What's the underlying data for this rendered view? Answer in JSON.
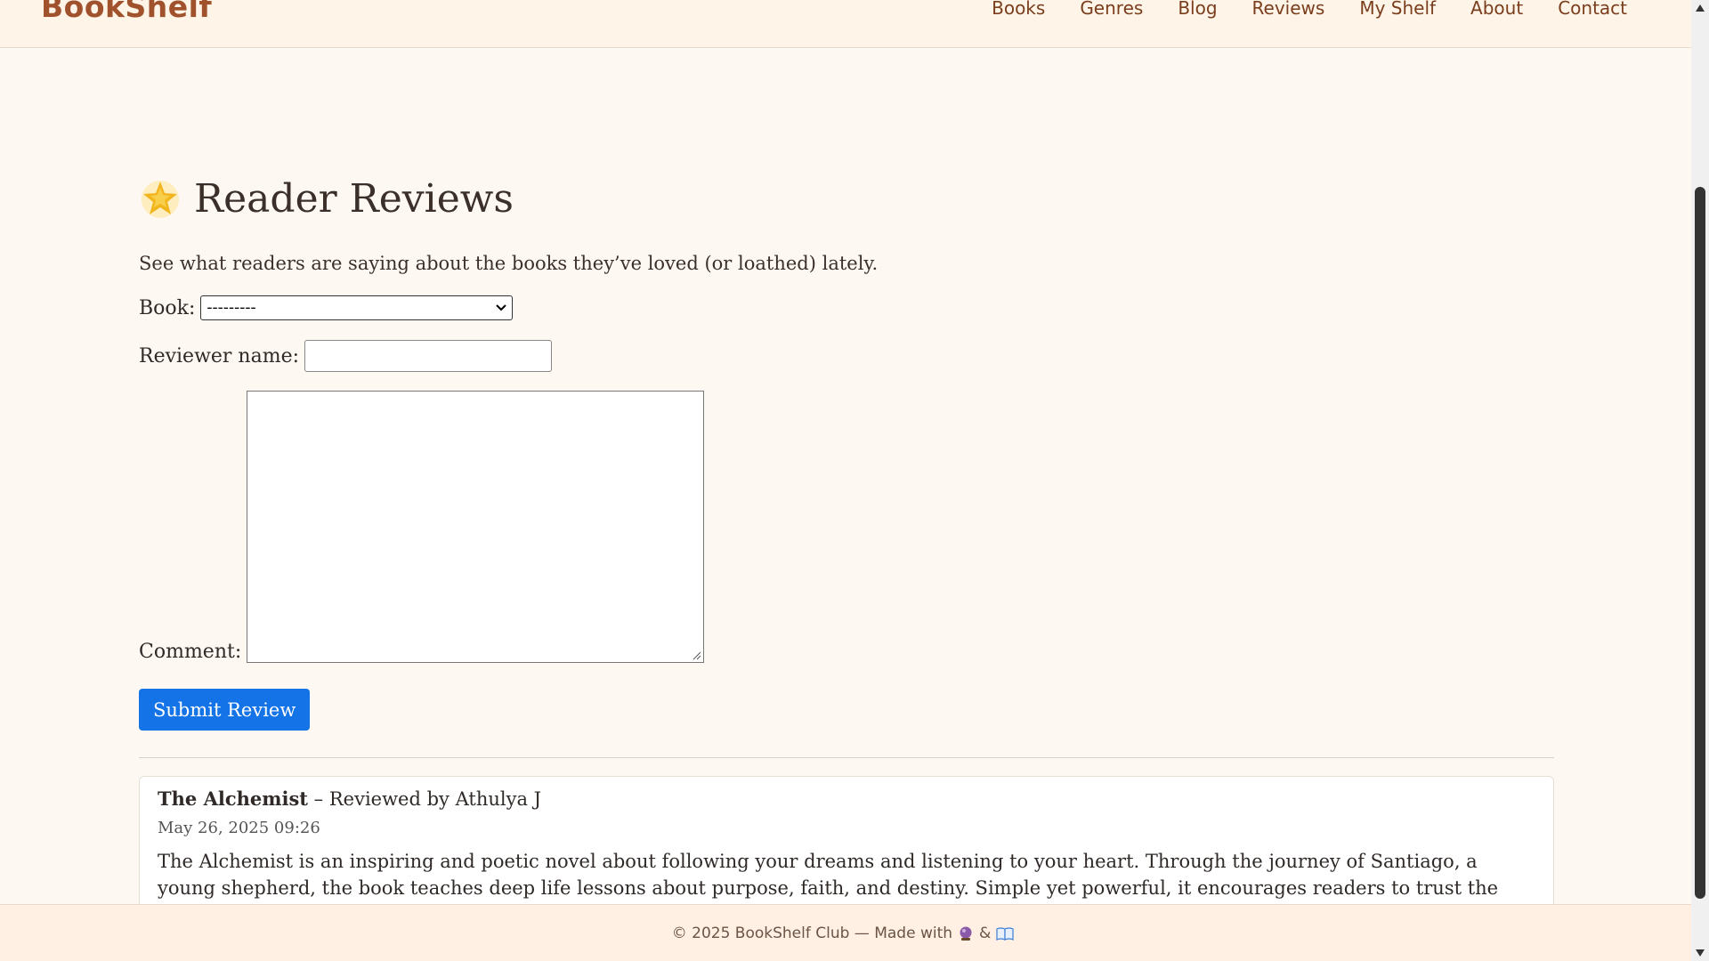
{
  "header": {
    "logo": "BookShelf",
    "nav": [
      "Books",
      "Genres",
      "Blog",
      "Reviews",
      "My Shelf",
      "About",
      "Contact"
    ]
  },
  "page": {
    "title": "Reader Reviews",
    "subtitle": "See what readers are saying about the books they’ve loved (or loathed) lately."
  },
  "form": {
    "book_label": "Book:",
    "book_selected": "---------",
    "reviewer_label": "Reviewer name:",
    "reviewer_value": "",
    "comment_label": "Comment:",
    "comment_value": "",
    "submit_label": "Submit Review"
  },
  "review": {
    "book": "The Alchemist",
    "by": " – Reviewed by Athulya J",
    "date": "May 26, 2025 09:26",
    "text": "The Alchemist is an inspiring and poetic novel about following your dreams and listening to your heart. Through the journey of Santiago, a young shepherd, the book teaches deep life lessons about purpose, faith, and destiny. Simple yet powerful, it encourages readers to trust the process of life."
  },
  "footer": {
    "text": "© 2025 BookShelf Club — Made with",
    "amp": "&"
  },
  "icons": {
    "title_icon": "glowing-star-icon",
    "footer_icon_1": "crystal-ball-icon",
    "footer_icon_2": "open-book-icon"
  }
}
